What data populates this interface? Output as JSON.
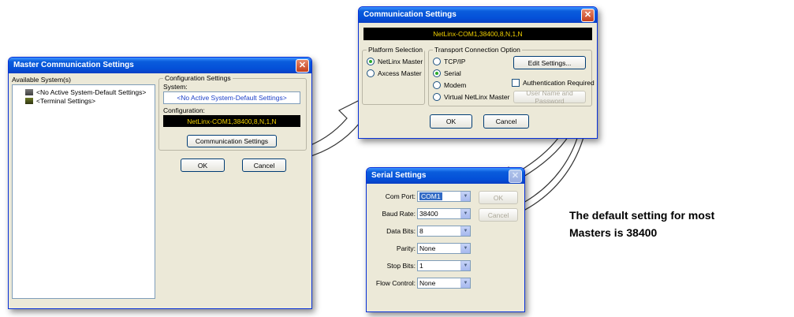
{
  "master_dialog": {
    "title": "Master Communication Settings",
    "available_label": "Available System(s)",
    "tree_items": [
      "<No Active System-Default Settings>",
      "<Terminal Settings>"
    ],
    "config_group_label": "Configuration Settings",
    "system_label": "System:",
    "system_value": "<No Active System-Default Settings>",
    "configuration_label": "Configuration:",
    "configuration_value": "NetLinx-COM1,38400,8,N,1,N",
    "comm_button": "Communication Settings",
    "ok": "OK",
    "cancel": "Cancel"
  },
  "comm_dialog": {
    "title": "Communication Settings",
    "banner": "NetLinx-COM1,38400,8,N,1,N",
    "platform_group": "Platform Selection",
    "platform_options": [
      "NetLinx Master",
      "Axcess Master"
    ],
    "transport_group": "Transport Connection Option",
    "transport_options": [
      "TCP/IP",
      "Serial",
      "Modem",
      "Virtual NetLinx Master"
    ],
    "edit_settings": "Edit Settings...",
    "auth_required": "Authentication Required",
    "user_name_password": "User Name and Password",
    "ok": "OK",
    "cancel": "Cancel"
  },
  "serial_dialog": {
    "title": "Serial Settings",
    "fields": [
      {
        "label": "Com Port:",
        "value": "COM1"
      },
      {
        "label": "Baud Rate:",
        "value": "38400"
      },
      {
        "label": "Data Bits:",
        "value": "8"
      },
      {
        "label": "Parity:",
        "value": "None"
      },
      {
        "label": "Stop Bits:",
        "value": "1"
      },
      {
        "label": "Flow Control:",
        "value": "None"
      }
    ],
    "ok": "OK",
    "cancel": "Cancel"
  },
  "callout": {
    "line1": "The default setting for most",
    "line2": "Masters is 38400"
  },
  "colors": {
    "title_blue": "#0a5ddc",
    "dialog_bg": "#ece9d8",
    "banner_text": "#f1d000",
    "selection": "#316ac5"
  }
}
